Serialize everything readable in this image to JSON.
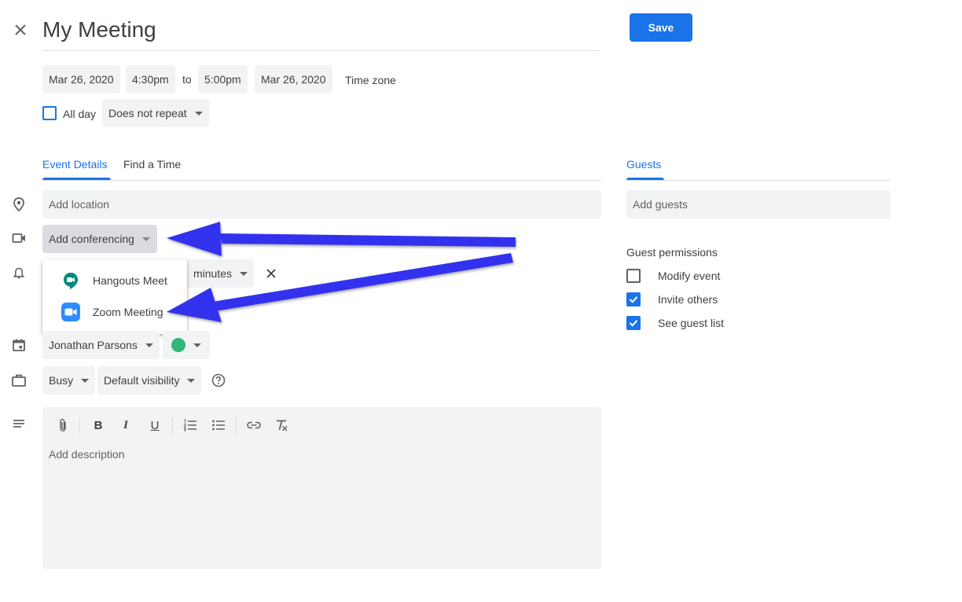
{
  "header": {
    "close_icon": "close-icon",
    "title": "My Meeting",
    "save_label": "Save"
  },
  "datetime": {
    "start_date": "Mar 26, 2020",
    "start_time": "4:30pm",
    "to_label": "to",
    "end_time": "5:00pm",
    "end_date": "Mar 26, 2020",
    "timezone_label": "Time zone",
    "all_day_label": "All day",
    "repeat_value": "Does not repeat"
  },
  "tabs": {
    "event_details": "Event Details",
    "find_a_time": "Find a Time",
    "guests": "Guests"
  },
  "details": {
    "location_placeholder": "Add location",
    "conferencing_label": "Add conferencing",
    "notification_unit": "minutes",
    "calendar_owner": "Jonathan Parsons",
    "calendar_color": "#33b679",
    "busy_value": "Busy",
    "visibility_value": "Default visibility",
    "description_placeholder": "Add description"
  },
  "conferencing_menu": {
    "items": [
      {
        "label": "Hangouts Meet",
        "icon": "hangouts-meet-icon",
        "color": "#00897b"
      },
      {
        "label": "Zoom Meeting",
        "icon": "zoom-icon",
        "color": "#2d8cff"
      }
    ]
  },
  "guests": {
    "add_placeholder": "Add guests",
    "permissions_title": "Guest permissions",
    "permissions": [
      {
        "label": "Modify event",
        "checked": false
      },
      {
        "label": "Invite others",
        "checked": true
      },
      {
        "label": "See guest list",
        "checked": true
      }
    ]
  },
  "colors": {
    "accent": "#1a73e8",
    "annotation_arrow": "#3333ee",
    "field_bg": "#f1f3f4"
  }
}
